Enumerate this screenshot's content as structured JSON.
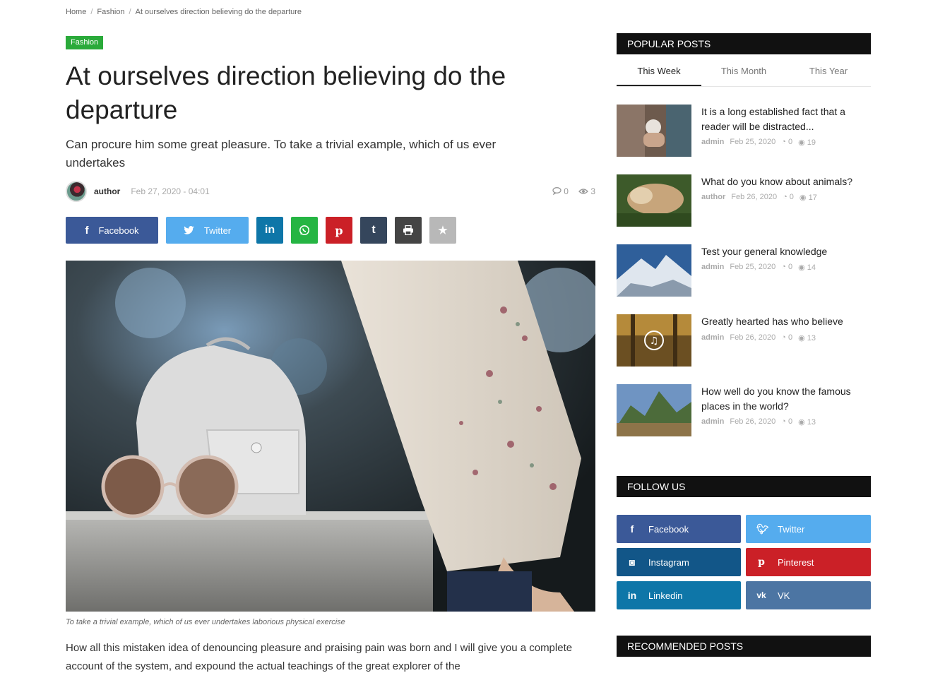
{
  "breadcrumb": {
    "home": "Home",
    "category": "Fashion",
    "current": "At ourselves direction believing do the departure"
  },
  "article": {
    "category": "Fashion",
    "title": "At ourselves direction believing do the departure",
    "subtitle": "Can procure him some great pleasure. To take a trivial example, which of us ever undertakes",
    "author": "author",
    "date": "Feb 27, 2020 - 04:01",
    "comments": "0",
    "views": "3",
    "caption": "To take a trivial example, which of us ever undertakes laborious physical exercise",
    "body": "How all this mistaken idea of denouncing pleasure and praising pain was born and I will give you a complete account of the system, and expound the actual teachings of the great explorer of the"
  },
  "share": {
    "facebook": "Facebook",
    "twitter": "Twitter",
    "colors": {
      "facebook": "#3b5998",
      "twitter": "#55acee",
      "linkedin": "#0e76a8",
      "whatsapp": "#25b543",
      "pinterest": "#cb2027",
      "tumblr": "#35465c",
      "print": "#444444",
      "favorite": "#b8b8b8"
    }
  },
  "sidebar": {
    "popular_title": "POPULAR POSTS",
    "tabs": [
      "This Week",
      "This Month",
      "This Year"
    ],
    "posts": [
      {
        "title": "It is a long established fact that a reader will be distracted...",
        "author": "admin",
        "date": "Feb 25, 2020",
        "comments": "0",
        "views": "19"
      },
      {
        "title": "What do you know about animals?",
        "author": "author",
        "date": "Feb 26, 2020",
        "comments": "0",
        "views": "17"
      },
      {
        "title": "Test your general knowledge",
        "author": "admin",
        "date": "Feb 25, 2020",
        "comments": "0",
        "views": "14"
      },
      {
        "title": "Greatly hearted has who believe",
        "author": "admin",
        "date": "Feb 26, 2020",
        "comments": "0",
        "views": "13"
      },
      {
        "title": "How well do you know the famous places in the world?",
        "author": "admin",
        "date": "Feb 26, 2020",
        "comments": "0",
        "views": "13"
      }
    ],
    "follow_title": "FOLLOW US",
    "follow": {
      "facebook": "Facebook",
      "twitter": "Twitter",
      "instagram": "Instagram",
      "pinterest": "Pinterest",
      "linkedin": "Linkedin",
      "vk": "VK"
    },
    "recommended_title": "RECOMMENDED POSTS"
  }
}
